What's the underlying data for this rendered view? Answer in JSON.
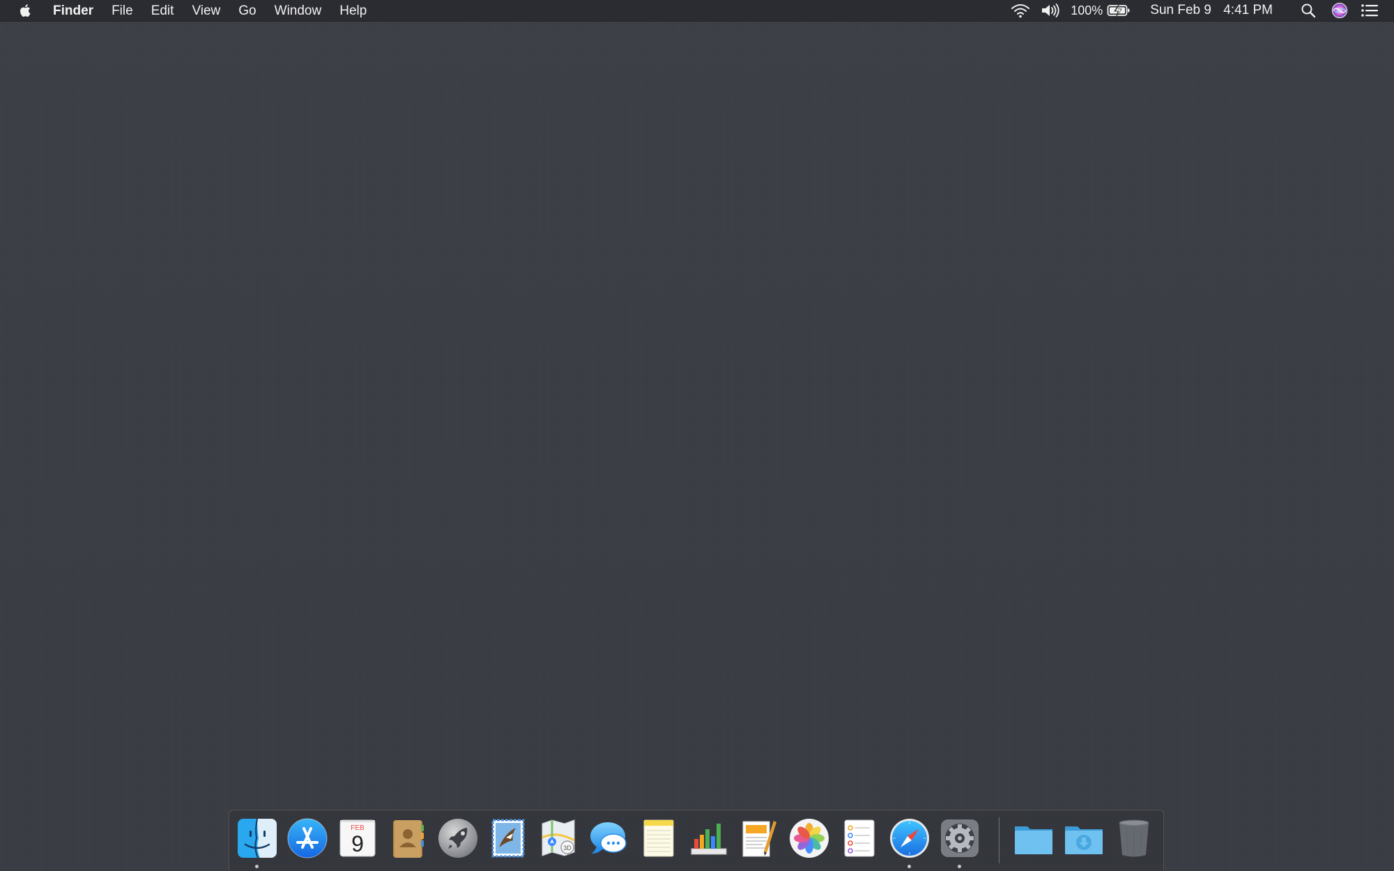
{
  "menubar": {
    "app_name": "Finder",
    "menus": [
      "File",
      "Edit",
      "View",
      "Go",
      "Window",
      "Help"
    ],
    "battery_percent": "100%",
    "date": "Sun Feb 9",
    "time": "4:41 PM",
    "icons": [
      "apple-icon",
      "wifi-icon",
      "volume-icon",
      "battery-charging-icon",
      "spotlight-search-icon",
      "siri-icon",
      "notification-center-icon"
    ]
  },
  "dock": {
    "calendar_month": "FEB",
    "calendar_day": "9",
    "apps": [
      "finder-icon",
      "app-store-icon",
      "calendar-icon",
      "contacts-icon",
      "launchpad-icon",
      "mail-icon",
      "maps-icon",
      "messages-icon",
      "notes-icon",
      "numbers-icon",
      "pages-icon",
      "photos-icon",
      "reminders-icon",
      "safari-icon",
      "system-preferences-icon"
    ],
    "stacks": [
      "applications-folder-icon",
      "downloads-folder-icon",
      "trash-icon"
    ],
    "running": [
      "finder-icon",
      "safari-icon",
      "system-preferences-icon"
    ]
  }
}
